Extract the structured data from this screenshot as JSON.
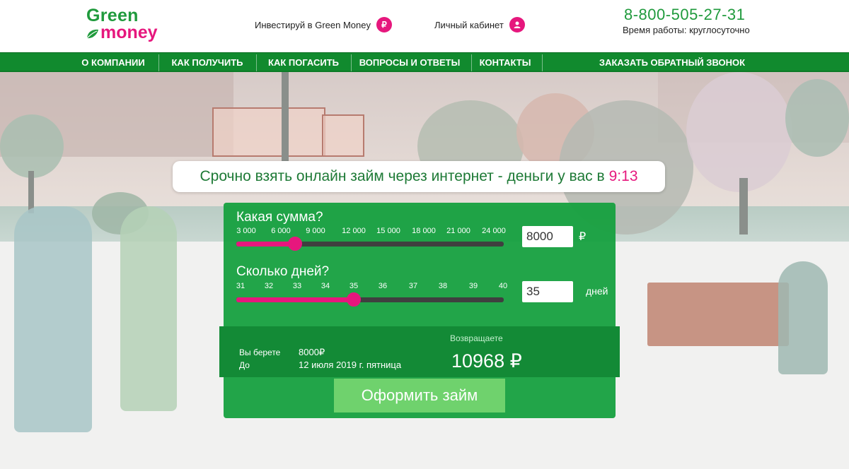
{
  "brand": {
    "line1": "Green",
    "line2": "money",
    "green": "#1f9a3c",
    "pink": "#e6177d"
  },
  "header": {
    "invest_label": "Инвестируй в Green Money",
    "invest_icon": "ruble-icon",
    "cabinet_label": "Личный кабинет",
    "cabinet_icon": "user-icon",
    "phone": "8-800-505-27-31",
    "hours": "Время работы: круглосуточно"
  },
  "nav": {
    "items": [
      "О КОМПАНИИ",
      "КАК ПОЛУЧИТЬ",
      "КАК ПОГАСИТЬ",
      "ВОПРОСЫ И ОТВЕТЫ",
      "КОНТАКТЫ",
      "ЗАКАЗАТЬ ОБРАТНЫЙ ЗВОНОК"
    ],
    "color": "#118a2e"
  },
  "hero": {
    "headline": "Срочно взять онлайн займ через интернет - деньги у вас в",
    "time": "9:13"
  },
  "calculator": {
    "amount": {
      "question": "Какая сумма?",
      "ticks": [
        "3 000",
        "6 000",
        "9 000",
        "12 000",
        "15 000",
        "18 000",
        "21 000",
        "24 000"
      ],
      "value": "8000",
      "unit": "₽",
      "level": 0.22
    },
    "days": {
      "question": "Сколько дней?",
      "ticks": [
        "31",
        "32",
        "33",
        "34",
        "35",
        "36",
        "37",
        "38",
        "39",
        "40"
      ],
      "value": "35",
      "unit": "дней",
      "level": 0.44
    },
    "summary": {
      "take_label": "Вы берете",
      "take_value": "8000₽",
      "until_label": "До",
      "until_value": "12 июля 2019 г. пятница",
      "return_label": "Возвращаете",
      "return_value": "10968 ₽"
    },
    "apply_label": "Оформить займ"
  }
}
